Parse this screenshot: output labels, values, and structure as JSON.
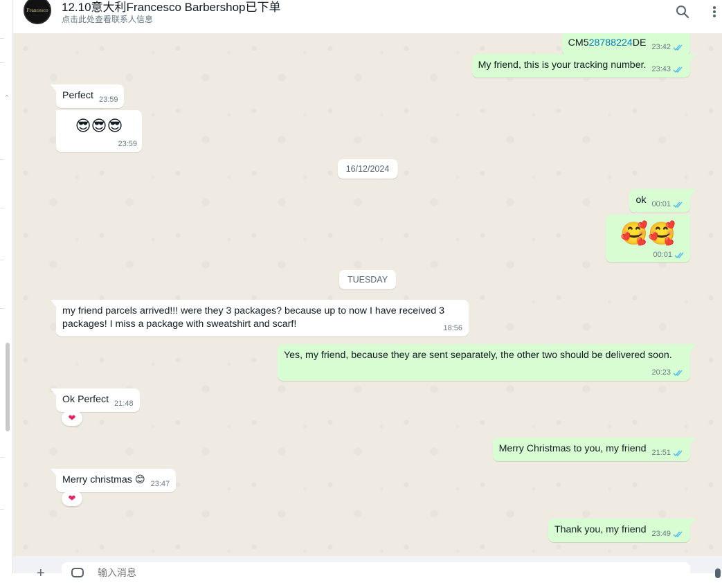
{
  "header": {
    "title": "12.10意大利Francesco Barbershop已下单",
    "subtitle": "点击此处查看联系人信息",
    "avatar_text": "Francesco"
  },
  "composer": {
    "placeholder": "输入消息"
  },
  "date_separators": [
    "16/12/2024",
    "TUESDAY"
  ],
  "messages": [
    {
      "dir": "out",
      "text_prefix": "CM5",
      "link": "28788224",
      "text_suffix": "DE",
      "time": "23:42",
      "ticks": "read"
    },
    {
      "dir": "out",
      "text": "My friend, this is your tracking number.",
      "time": "23:43",
      "ticks": "read"
    },
    {
      "dir": "in",
      "text": "Perfect",
      "time": "23:59"
    },
    {
      "dir": "in",
      "text": "😎😎😎",
      "time": "23:59"
    },
    {
      "dir": "out",
      "text": "ok",
      "time": "00:01",
      "ticks": "read"
    },
    {
      "dir": "out",
      "text": "🥰🥰",
      "time": "00:01",
      "ticks": "read"
    },
    {
      "dir": "in",
      "text": "my friend parcels arrived!!! were they 3 packages? because up to now I have received 3 packages! I miss a package with sweatshirt and scarf!",
      "time": "18:56"
    },
    {
      "dir": "out",
      "text": "Yes, my friend, because they are sent separately, the other two should be delivered soon.",
      "time": "20:23",
      "ticks": "read"
    },
    {
      "dir": "in",
      "text": "Ok Perfect",
      "time": "21:48",
      "reaction": "❤"
    },
    {
      "dir": "out",
      "text": "Merry Christmas to you, my friend",
      "time": "21:51",
      "ticks": "read"
    },
    {
      "dir": "in",
      "text": "Merry christmas 😊",
      "time": "23:47",
      "reaction": "❤"
    },
    {
      "dir": "out",
      "text": "Thank you, my friend",
      "time": "23:49",
      "ticks": "read"
    }
  ],
  "colors": {
    "outgoing_bubble": "#d9fdd3",
    "incoming_bubble": "#ffffff",
    "chat_background": "#efeae2",
    "read_ticks": "#53bdeb",
    "link": "#027eb5"
  },
  "icons": {
    "search": "search-icon",
    "menu": "menu-dots-icon",
    "ticks": "double-check-icon",
    "reaction": "heart-icon"
  }
}
